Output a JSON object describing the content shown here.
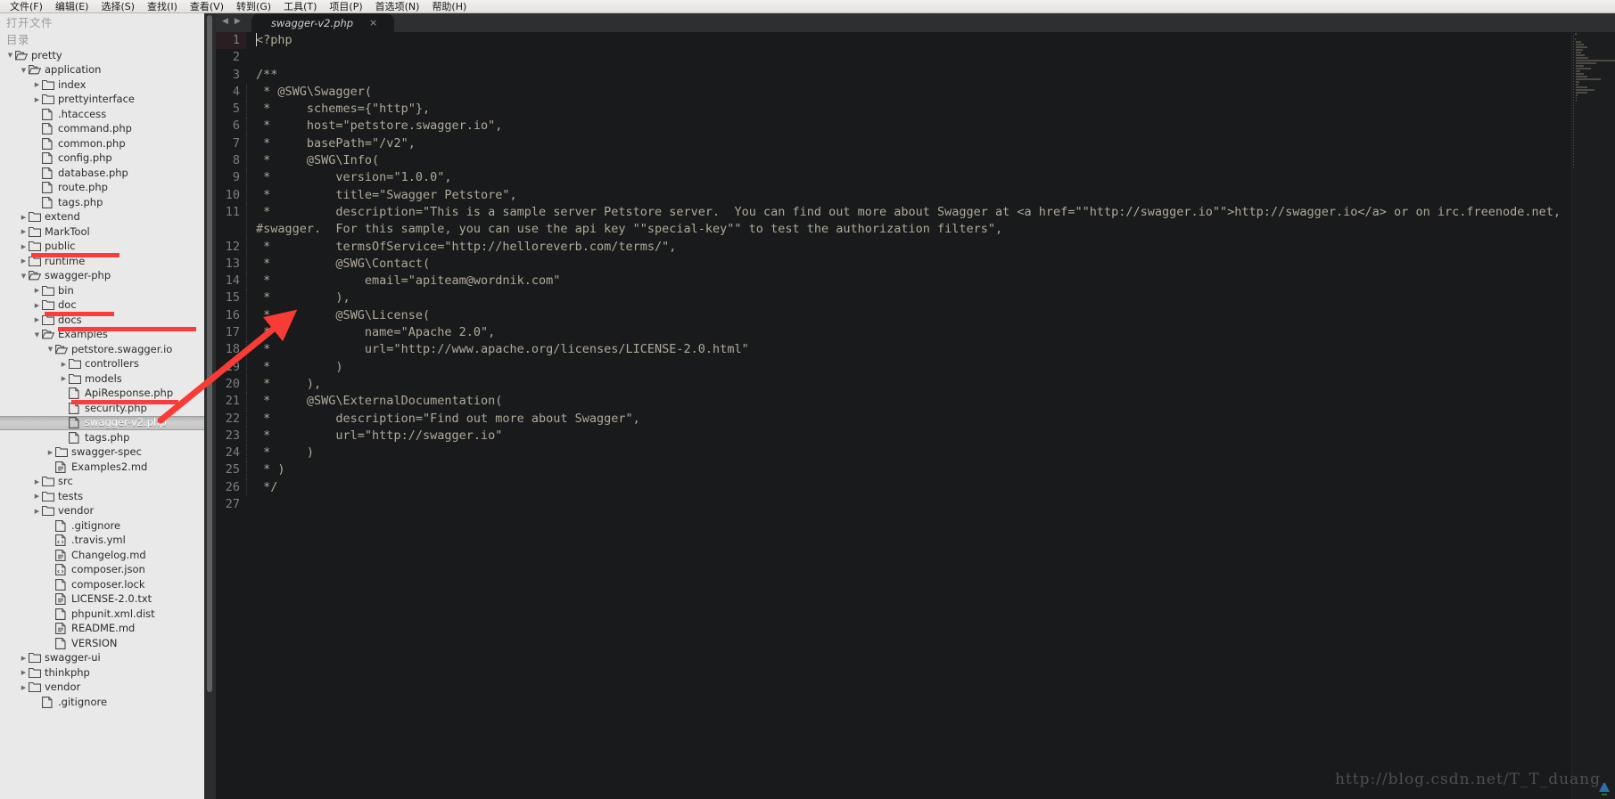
{
  "menubar": {
    "items": [
      {
        "label": "文件(F)"
      },
      {
        "label": "编辑(E)"
      },
      {
        "label": "选择(S)"
      },
      {
        "label": "查找(I)"
      },
      {
        "label": "查看(V)"
      },
      {
        "label": "转到(G)"
      },
      {
        "label": "工具(T)"
      },
      {
        "label": "项目(P)"
      },
      {
        "label": "首选项(N)"
      },
      {
        "label": "帮助(H)"
      }
    ]
  },
  "sidebar": {
    "open_files_label": "打开文件",
    "folders_label": "目录",
    "tree": [
      {
        "label": "pretty",
        "depth": 0,
        "kind": "folder-open",
        "twisty": "down"
      },
      {
        "label": "application",
        "depth": 1,
        "kind": "folder-open",
        "twisty": "down"
      },
      {
        "label": "index",
        "depth": 2,
        "kind": "folder",
        "twisty": "right"
      },
      {
        "label": "prettyinterface",
        "depth": 2,
        "kind": "folder",
        "twisty": "right"
      },
      {
        "label": ".htaccess",
        "depth": 2,
        "kind": "file",
        "twisty": ""
      },
      {
        "label": "command.php",
        "depth": 2,
        "kind": "file",
        "twisty": ""
      },
      {
        "label": "common.php",
        "depth": 2,
        "kind": "file",
        "twisty": ""
      },
      {
        "label": "config.php",
        "depth": 2,
        "kind": "file",
        "twisty": ""
      },
      {
        "label": "database.php",
        "depth": 2,
        "kind": "file",
        "twisty": ""
      },
      {
        "label": "route.php",
        "depth": 2,
        "kind": "file",
        "twisty": ""
      },
      {
        "label": "tags.php",
        "depth": 2,
        "kind": "file",
        "twisty": ""
      },
      {
        "label": "extend",
        "depth": 1,
        "kind": "folder",
        "twisty": "right"
      },
      {
        "label": "MarkTool",
        "depth": 1,
        "kind": "folder",
        "twisty": "right"
      },
      {
        "label": "public",
        "depth": 1,
        "kind": "folder",
        "twisty": "right"
      },
      {
        "label": "runtime",
        "depth": 1,
        "kind": "folder",
        "twisty": "right"
      },
      {
        "label": "swagger-php",
        "depth": 1,
        "kind": "folder-open",
        "twisty": "down",
        "marked": true
      },
      {
        "label": "bin",
        "depth": 2,
        "kind": "folder",
        "twisty": "right"
      },
      {
        "label": "doc",
        "depth": 2,
        "kind": "folder",
        "twisty": "right"
      },
      {
        "label": "docs",
        "depth": 2,
        "kind": "folder",
        "twisty": "right"
      },
      {
        "label": "Examples",
        "depth": 2,
        "kind": "folder-open",
        "twisty": "down",
        "marked": true
      },
      {
        "label": "petstore.swagger.io",
        "depth": 3,
        "kind": "folder-open",
        "twisty": "down",
        "marked": true
      },
      {
        "label": "controllers",
        "depth": 4,
        "kind": "folder",
        "twisty": "right"
      },
      {
        "label": "models",
        "depth": 4,
        "kind": "folder",
        "twisty": "right"
      },
      {
        "label": "ApiResponse.php",
        "depth": 4,
        "kind": "file",
        "twisty": ""
      },
      {
        "label": "security.php",
        "depth": 4,
        "kind": "file",
        "twisty": ""
      },
      {
        "label": "swagger-v2.php",
        "depth": 4,
        "kind": "file",
        "twisty": "",
        "selected": true,
        "marked": true
      },
      {
        "label": "tags.php",
        "depth": 4,
        "kind": "file",
        "twisty": ""
      },
      {
        "label": "swagger-spec",
        "depth": 3,
        "kind": "folder",
        "twisty": "right"
      },
      {
        "label": "Examples2.md",
        "depth": 3,
        "kind": "file-doc",
        "twisty": ""
      },
      {
        "label": "src",
        "depth": 2,
        "kind": "folder",
        "twisty": "right"
      },
      {
        "label": "tests",
        "depth": 2,
        "kind": "folder",
        "twisty": "right"
      },
      {
        "label": "vendor",
        "depth": 2,
        "kind": "folder",
        "twisty": "right"
      },
      {
        "label": ".gitignore",
        "depth": 3,
        "kind": "file",
        "twisty": ""
      },
      {
        "label": ".travis.yml",
        "depth": 3,
        "kind": "file-code",
        "twisty": ""
      },
      {
        "label": "Changelog.md",
        "depth": 3,
        "kind": "file-doc",
        "twisty": ""
      },
      {
        "label": "composer.json",
        "depth": 3,
        "kind": "file-code",
        "twisty": ""
      },
      {
        "label": "composer.lock",
        "depth": 3,
        "kind": "file",
        "twisty": ""
      },
      {
        "label": "LICENSE-2.0.txt",
        "depth": 3,
        "kind": "file-doc",
        "twisty": ""
      },
      {
        "label": "phpunit.xml.dist",
        "depth": 3,
        "kind": "file",
        "twisty": ""
      },
      {
        "label": "README.md",
        "depth": 3,
        "kind": "file-doc",
        "twisty": ""
      },
      {
        "label": "VERSION",
        "depth": 3,
        "kind": "file",
        "twisty": ""
      },
      {
        "label": "swagger-ui",
        "depth": 1,
        "kind": "folder",
        "twisty": "right"
      },
      {
        "label": "thinkphp",
        "depth": 1,
        "kind": "folder",
        "twisty": "right"
      },
      {
        "label": "vendor",
        "depth": 1,
        "kind": "folder",
        "twisty": "right"
      },
      {
        "label": ".gitignore",
        "depth": 2,
        "kind": "file",
        "twisty": ""
      }
    ]
  },
  "editor": {
    "nav_prev_icon": "◀",
    "nav_next_icon": "▶",
    "tab": {
      "title": "swagger-v2.php",
      "close_icon": "×"
    },
    "lines": [
      {
        "n": "1",
        "text": "<?php",
        "caret": true
      },
      {
        "n": "2",
        "text": ""
      },
      {
        "n": "3",
        "text": "/**"
      },
      {
        "n": "4",
        "text": " * @SWG\\Swagger(",
        "indent": true
      },
      {
        "n": "5",
        "text": " *     schemes={\"http\"},",
        "indent": true
      },
      {
        "n": "6",
        "text": " *     host=\"petstore.swagger.io\",",
        "indent": true
      },
      {
        "n": "7",
        "text": " *     basePath=\"/v2\",",
        "indent": true
      },
      {
        "n": "8",
        "text": " *     @SWG\\Info(",
        "indent": true
      },
      {
        "n": "9",
        "text": " *         version=\"1.0.0\",",
        "indent": true
      },
      {
        "n": "10",
        "text": " *         title=\"Swagger Petstore\",",
        "indent": true
      },
      {
        "n": "11",
        "text": " *         description=\"This is a sample server Petstore server.  You can find out more about Swagger at <a href=\"\"http://swagger.io\"\">http://swagger.io</a> or on irc.freenode.net, #swagger.  For this sample, you can use the api key \"\"special-key\"\" to test the authorization filters\",",
        "indent": true
      },
      {
        "n": "12",
        "text": " *         termsOfService=\"http://helloreverb.com/terms/\",",
        "indent": true
      },
      {
        "n": "13",
        "text": " *         @SWG\\Contact(",
        "indent": true
      },
      {
        "n": "14",
        "text": " *             email=\"apiteam@wordnik.com\"",
        "indent": true
      },
      {
        "n": "15",
        "text": " *         ),",
        "indent": true
      },
      {
        "n": "16",
        "text": " *         @SWG\\License(",
        "indent": true
      },
      {
        "n": "17",
        "text": " *             name=\"Apache 2.0\",",
        "indent": true
      },
      {
        "n": "18",
        "text": " *             url=\"http://www.apache.org/licenses/LICENSE-2.0.html\"",
        "indent": true
      },
      {
        "n": "19",
        "text": " *         )",
        "indent": true
      },
      {
        "n": "20",
        "text": " *     ),",
        "indent": true
      },
      {
        "n": "21",
        "text": " *     @SWG\\ExternalDocumentation(",
        "indent": true
      },
      {
        "n": "22",
        "text": " *         description=\"Find out more about Swagger\",",
        "indent": true
      },
      {
        "n": "23",
        "text": " *         url=\"http://swagger.io\"",
        "indent": true
      },
      {
        "n": "24",
        "text": " *     )",
        "indent": true
      },
      {
        "n": "25",
        "text": " * )",
        "indent": true
      },
      {
        "n": "26",
        "text": " */",
        "indent": true
      },
      {
        "n": "27",
        "text": ""
      }
    ]
  },
  "watermark": {
    "text": "http://blog.csdn.net/T_T_duang"
  },
  "annotation": {
    "arrow_color": "#f93b36",
    "underline_color": "#fa3c3c",
    "arrow_tip_label": "points-to-swagger-v2-php"
  },
  "colors": {
    "editor_bg": "#181a1b",
    "sidebar_bg": "#e9e9e9",
    "code_fg": "#b0aa9a",
    "line_no_fg": "#7b7f81",
    "accent_red": "#fa3c3c"
  }
}
